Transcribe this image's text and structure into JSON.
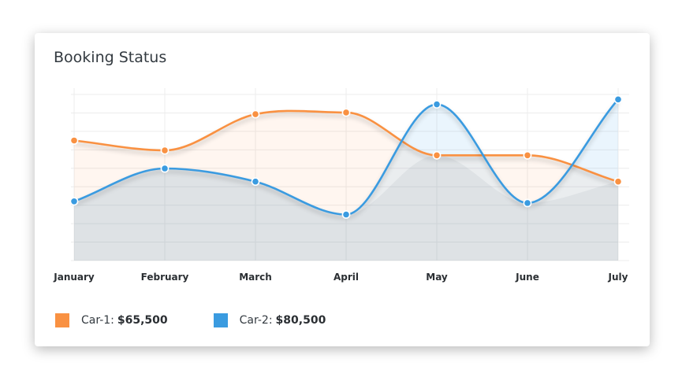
{
  "card": {
    "title": "Booking Status"
  },
  "legend": {
    "items": [
      {
        "label": "Car-1:",
        "value": "$65,500",
        "color": "#f99142"
      },
      {
        "label": "Car-2:",
        "value": "$80,500",
        "color": "#3a9be0"
      }
    ]
  },
  "chart_data": {
    "type": "area",
    "categories": [
      "January",
      "February",
      "March",
      "April",
      "May",
      "June",
      "July"
    ],
    "series": [
      {
        "name": "Car-1",
        "color": "#f99142",
        "values": [
          55,
          49,
          71,
          72,
          46,
          46,
          30
        ]
      },
      {
        "name": "Car-2",
        "color": "#3a9be0",
        "values": [
          18,
          38,
          30,
          10,
          77,
          17,
          80
        ]
      }
    ],
    "ylim": [
      -18,
      83
    ],
    "grid": true,
    "smooth": true,
    "legend_position": "bottom-left"
  }
}
